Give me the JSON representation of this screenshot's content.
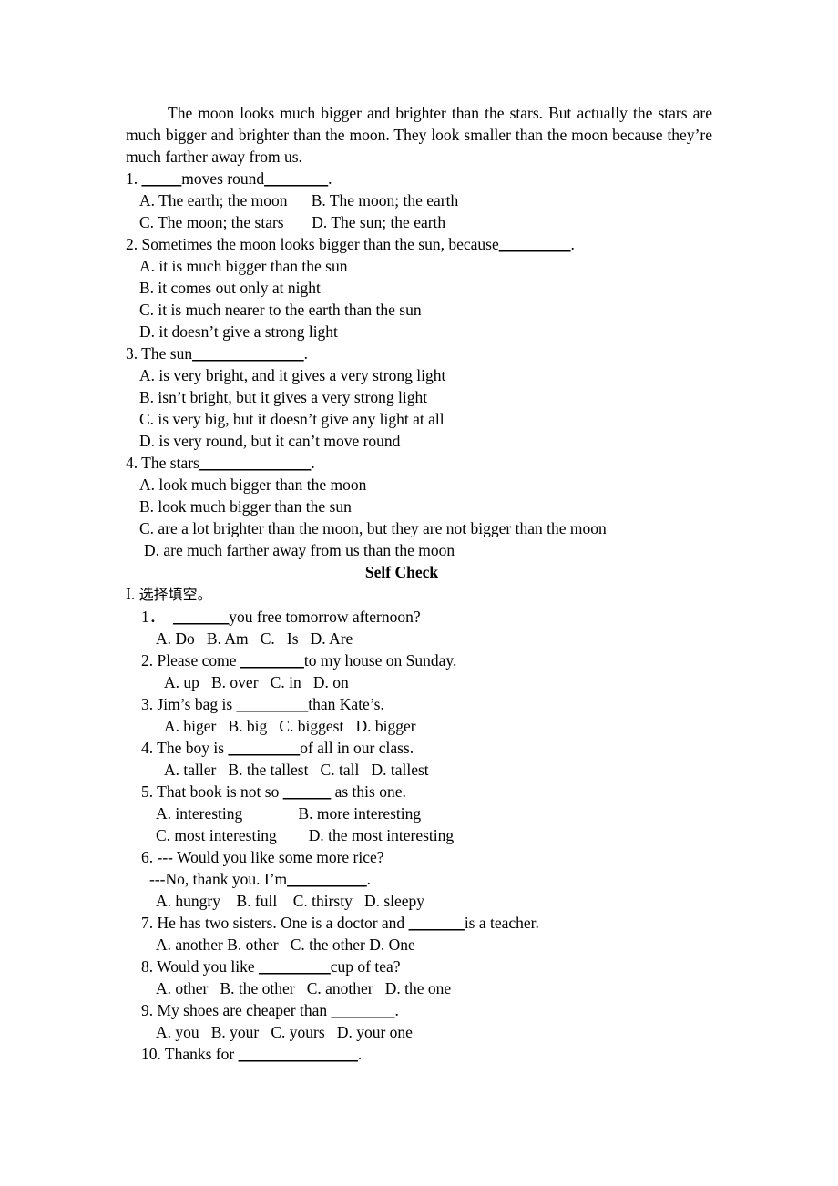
{
  "document": {
    "passage": "The moon looks much bigger and brighter than the stars. But actually the stars are much bigger and brighter than the moon. They look smaller than the moon because they’re much farther away from us.",
    "reading_questions": [
      {
        "stem_before": "1. ",
        "blank1": "_____",
        "stem_mid": "moves round",
        "blank2": "________",
        "stem_after": ".",
        "options_rows": [
          "A. The earth; the moon      B. The moon; the earth",
          "C. The moon; the stars       D. The sun; the earth"
        ]
      },
      {
        "stem": "2. Sometimes the moon looks bigger than the sun, because",
        "blank": "_________",
        "stem_after": ".",
        "options": [
          "A. it is much bigger than the sun",
          "B. it comes out only at night",
          "C. it is much nearer to the earth than the sun",
          "D. it doesn’t give a strong light"
        ]
      },
      {
        "stem": "3. The sun",
        "blank": "______________",
        "stem_after": ".",
        "options": [
          "A. is very bright, and it gives a very strong light",
          "B. isn’t bright, but it gives a very strong light",
          "C. is very big, but it doesn’t give any light at all",
          "D. is very round, but it can’t move round"
        ]
      },
      {
        "stem": "4. The stars",
        "blank": "______________",
        "stem_after": ".",
        "options": [
          "A. look much bigger than the moon",
          "B. look much bigger than the sun",
          "C. are a lot brighter than the moon, but they are not bigger than the moon",
          "D. are much farther away from us than the moon"
        ]
      }
    ],
    "self_check_title": "Self    Check",
    "section_marker": "I.",
    "section_title_cjk": "选择填空。",
    "self_check_questions": [
      {
        "stem_before": "1．  ",
        "blank": "_______",
        "stem_after": "you free tomorrow afternoon?",
        "options_row": "A. Do   B. Am   C.   Is   D. Are"
      },
      {
        "stem_before": "2. Please come ",
        "blank": "________",
        "stem_after": "to my house on Sunday.",
        "options_row": "A. up   B. over   C. in   D. on"
      },
      {
        "stem_before": "3. Jim’s bag is ",
        "blank": "_________",
        "stem_after": "than Kate’s.",
        "options_row": "A. biger   B. big   C. biggest   D. bigger"
      },
      {
        "stem_before": "4. The boy is ",
        "blank": "_________",
        "stem_after": "of all in our class.",
        "options_row": "A. taller   B. the tallest   C. tall   D. tallest"
      },
      {
        "stem_before": "5. That book is not so ",
        "blank": "______",
        "stem_after": " as this one.",
        "options_rows": [
          "A. interesting              B. more interesting",
          "C. most interesting        D. the most interesting"
        ]
      },
      {
        "stem_line1": "6. --- Would you like some more rice?",
        "stem_line2_before": "---No, thank you. I’m",
        "blank": "__________",
        "stem_line2_after": ".",
        "options_row": "A. hungry    B. full    C. thirsty   D. sleepy"
      },
      {
        "stem_before": "7. He has two sisters. One is a doctor and ",
        "blank": "_______",
        "stem_after": "is a teacher.",
        "options_row": "A. another B. other   C. the other D. One"
      },
      {
        "stem_before": "8. Would you like ",
        "blank": "_________",
        "stem_after": "cup of tea?",
        "options_row": "A. other   B. the other   C. another   D. the one"
      },
      {
        "stem_before": "9. My shoes are cheaper than ",
        "blank": "________",
        "stem_after": ".",
        "options_row": "A. you   B. your   C. yours   D. your one"
      },
      {
        "stem_before": "10. Thanks for ",
        "blank": "_______________",
        "stem_after": ".",
        "options_row": ""
      }
    ]
  }
}
